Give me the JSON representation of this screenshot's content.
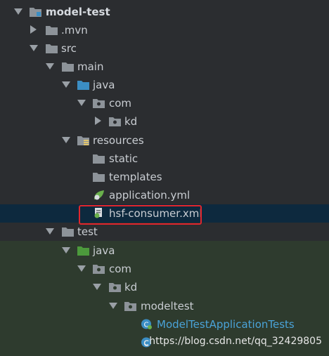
{
  "project": {
    "name": "model-test"
  },
  "tree": {
    "mvn": ".mvn",
    "src": "src",
    "main": "main",
    "main_java": "java",
    "main_com": "com",
    "kd": "kd",
    "resources": "resources",
    "static": "static",
    "templates": "templates",
    "application_yml": "application.yml",
    "hsf_consumer": "hsf-consumer.xml",
    "test": "test",
    "test_java": "java",
    "test_com": "com",
    "test_kd": "kd",
    "modeltest": "modeltest",
    "model_test_class": "ModelTestApplicationTests",
    "partial_item": "c"
  },
  "watermark": "https://blog.csdn.net/qq_32429805",
  "colors": {
    "folder": "#8d9399",
    "source_folder": "#3b8ec4",
    "test_folder": "#4c9a3c",
    "class": "#4aa3d8",
    "highlight": "#e0262d",
    "selection": "#0d293e"
  }
}
